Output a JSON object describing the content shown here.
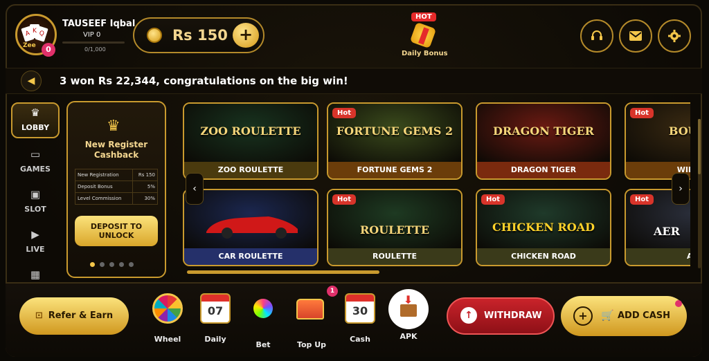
{
  "header": {
    "username": "TAUSEEF Iqbal",
    "vip_level": "VIP 0",
    "vip_progress": "0/1,000",
    "vip_progress_fraction": 0.0,
    "avatar_logo": "Zee",
    "notification_count": "0",
    "balance": "Rs 150",
    "add_balance_label": "+",
    "daily_bonus_hot": "HOT",
    "daily_bonus_label": "Daily Bonus",
    "icons": [
      "headset-icon",
      "mail-icon",
      "settings-icon"
    ]
  },
  "marquee": {
    "text": "3 won Rs 22,344, congratulations on the big win!"
  },
  "sidenav": {
    "items": [
      {
        "label": "LOBBY",
        "icon": "crown-icon",
        "active": true
      },
      {
        "label": "GAMES",
        "icon": "gamepad-icon",
        "active": false
      },
      {
        "label": "SLOT",
        "icon": "slot-icon",
        "active": false
      },
      {
        "label": "LIVE",
        "icon": "play-icon",
        "active": false
      },
      {
        "label": "",
        "icon": "calendar-icon",
        "active": false
      }
    ]
  },
  "promo": {
    "title": "New Register Cashback",
    "rows": [
      {
        "label": "New Registration",
        "value": "Rs 150"
      },
      {
        "label": "Deposit Bonus",
        "value": "5%"
      },
      {
        "label": "Level Commission",
        "value": "30%"
      }
    ],
    "button": "DEPOSIT TO UNLOCK",
    "slides": 5,
    "active_slide": 0
  },
  "games": {
    "hot_label": "Hot",
    "tiles": [
      {
        "name": "ZOO ROULETTE",
        "art": "ZOO ROULETTE",
        "hot": false,
        "label_bg": "#4a3a0e",
        "art_bg": "#18331f"
      },
      {
        "name": "FORTUNE GEMS 2",
        "art": "FORTUNE GEMS 2",
        "hot": true,
        "label_bg": "#6b3d0a",
        "art_bg": "#3a4a1c"
      },
      {
        "name": "DRAGON TIGER",
        "art": "DRAGON TIGER",
        "hot": false,
        "label_bg": "#7a2a0e",
        "art_bg": "#6a1a12"
      },
      {
        "name": "WILD B",
        "art": "BOUNT",
        "hot": true,
        "label_bg": "#6b3d0a",
        "art_bg": "#3a2a12"
      },
      {
        "name": "CAR ROULETTE",
        "art": "",
        "hot": false,
        "label_bg": "#25306a",
        "art_bg": "#1b2750"
      },
      {
        "name": "ROULETTE",
        "art": "ROULETTE",
        "hot": true,
        "label_bg": "#3a3a1a",
        "art_bg": "#1e3a22"
      },
      {
        "name": "CHICKEN ROAD",
        "art": "CHICKEN ROAD",
        "hot": true,
        "label_bg": "#3a3a1a",
        "art_bg": "#1f3a2a"
      },
      {
        "name": "AE",
        "art": "AER",
        "hot": true,
        "label_bg": "#3a3a1a",
        "art_bg": "#2a2e3a"
      }
    ]
  },
  "bottom": {
    "refer": "Refer & Earn",
    "quick_items": [
      {
        "label": "Wheel",
        "icon": "wheel-icon"
      },
      {
        "label": "Daily",
        "icon": "calendar-07-icon",
        "value": "07"
      },
      {
        "label": "Bet",
        "icon": "bet-wheel-icon"
      },
      {
        "label": "Top Up",
        "icon": "treasure-chest-icon",
        "badge": "1"
      },
      {
        "label": "Cash",
        "icon": "calendar-30-icon",
        "value": "30"
      },
      {
        "label": "APK",
        "icon": "download-box-icon"
      }
    ],
    "withdraw": "WITHDRAW",
    "add_cash": "ADD CASH"
  },
  "colors": {
    "gold": "#c99a2e",
    "gold_light": "#fbe27c",
    "hot_red": "#d8342a",
    "withdraw_red": "#c9232a",
    "background": "#0b0905"
  }
}
